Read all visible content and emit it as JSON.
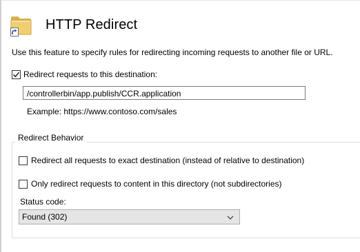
{
  "header": {
    "title": "HTTP Redirect",
    "icon": "folder-shortcut-icon"
  },
  "description": "Use this feature to specify rules for redirecting incoming requests to another file or URL.",
  "redirect_destination": {
    "checkbox_label": "Redirect requests to this destination:",
    "checked": true,
    "value": "/controllerbin/app.publish/CCR.application",
    "example": "Example: https://www.contoso.com/sales"
  },
  "redirect_behavior": {
    "caption": "Redirect Behavior",
    "exact_destination": {
      "label": "Redirect all requests to exact destination (instead of relative to destination)",
      "checked": false
    },
    "only_this_directory": {
      "label": "Only redirect requests to content in this directory (not subdirectories)",
      "checked": false
    },
    "status_code": {
      "label": "Status code:",
      "selected": "Found (302)"
    }
  },
  "colors": {
    "folder": "#e7c66b",
    "checkmark": "#000000"
  }
}
